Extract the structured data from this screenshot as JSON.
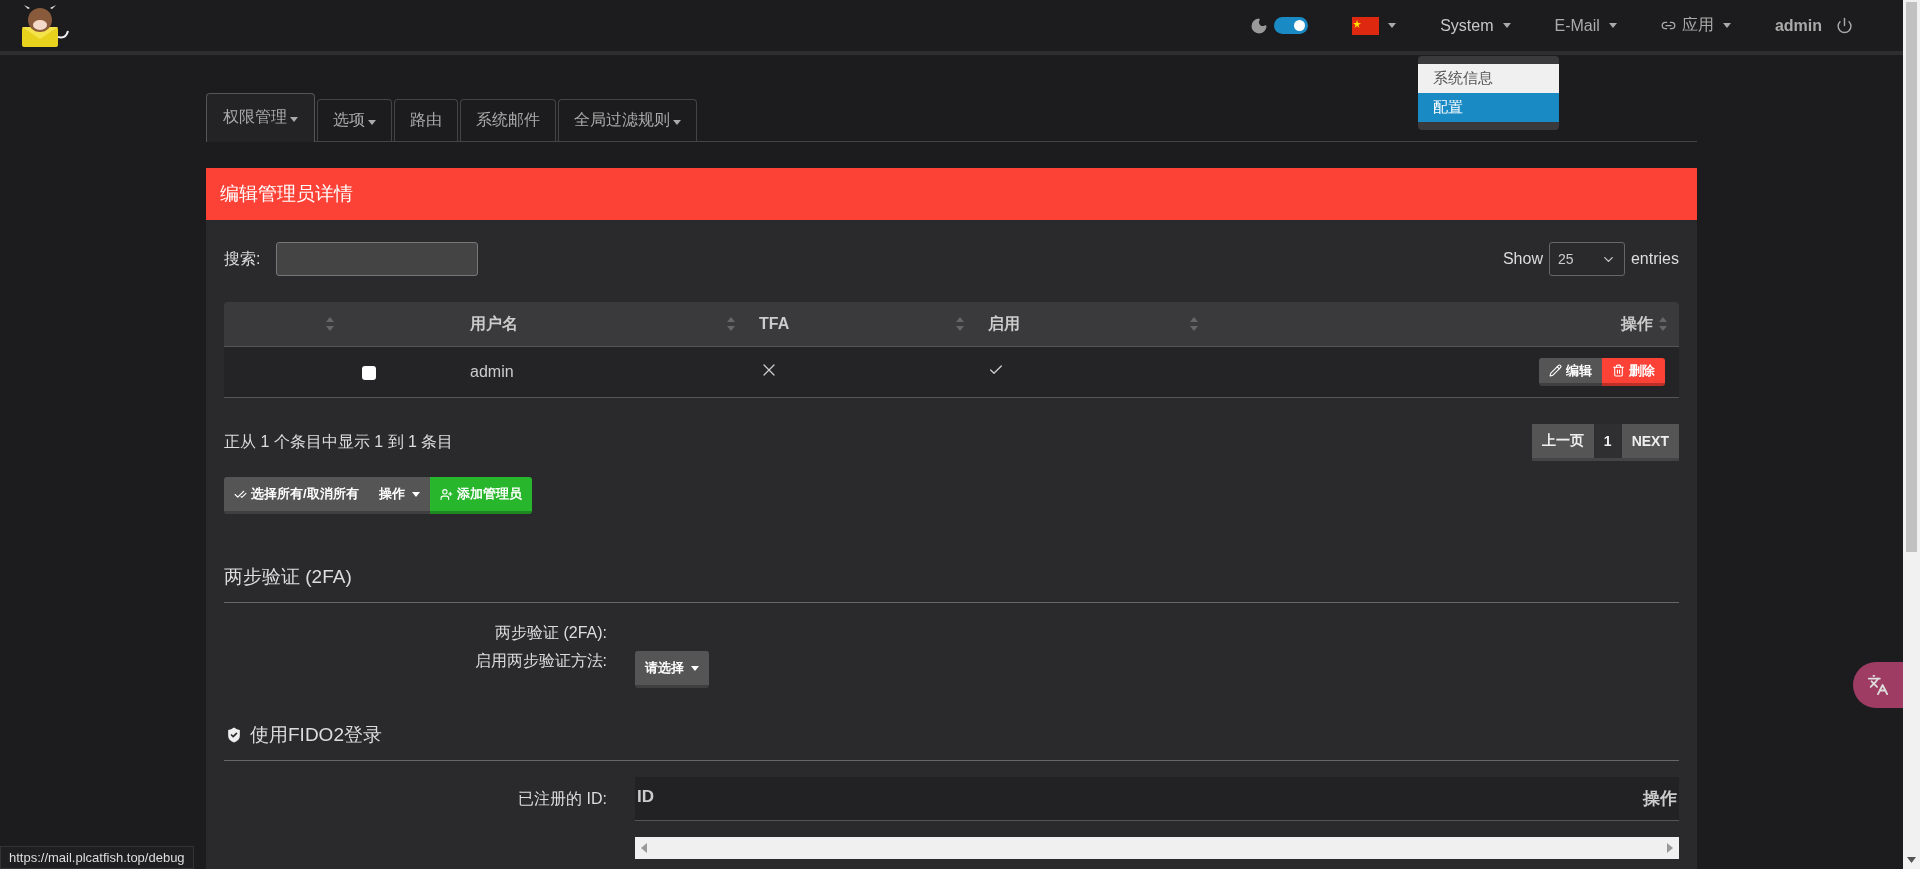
{
  "navbar": {
    "theme_toggle": {
      "on": true
    },
    "language": {
      "kind": "flag"
    },
    "menus": [
      {
        "label": "System",
        "kind": "text",
        "expanded": true,
        "items": [
          {
            "label": "系统信息",
            "selected": false
          },
          {
            "label": "配置",
            "selected": true
          }
        ]
      },
      {
        "label": "E-Mail",
        "kind": "text",
        "expanded": false
      },
      {
        "label": "应用",
        "kind": "link",
        "expanded": false
      }
    ],
    "user": "admin"
  },
  "tabs": [
    {
      "label": "权限管理",
      "selected": true,
      "dropdown": true
    },
    {
      "label": "选项",
      "selected": false,
      "dropdown": true
    },
    {
      "label": "路由",
      "selected": false,
      "dropdown": false
    },
    {
      "label": "系统邮件",
      "selected": false,
      "dropdown": false
    },
    {
      "label": "全局过滤规则",
      "selected": false,
      "dropdown": true
    }
  ],
  "panel": {
    "title": "编辑管理员详情",
    "search_label": "搜索:",
    "length": {
      "show": "Show",
      "value": "25",
      "entries": "entries"
    },
    "table": {
      "columns": [
        "用户名",
        "TFA",
        "启用",
        "操作"
      ],
      "rows": [
        {
          "checked": false,
          "username": "admin",
          "tfa": false,
          "active": true,
          "actions": [
            {
              "label": "编辑",
              "kind": "edit"
            },
            {
              "label": "删除",
              "kind": "delete"
            }
          ]
        }
      ]
    },
    "info": "正从 1 个条目中显示 1 到 1 条目",
    "pagination": [
      {
        "label": "上一页",
        "selected": false
      },
      {
        "label": "1",
        "selected": true
      },
      {
        "label": "NEXT",
        "selected": false
      }
    ],
    "bulk_buttons": [
      {
        "label": "选择所有/取消所有",
        "kind": "select-all"
      },
      {
        "label": "操作",
        "kind": "dropdown"
      },
      {
        "label": "添加管理员",
        "kind": "add"
      }
    ],
    "two_fa": {
      "heading": "两步验证 (2FA)",
      "labels": [
        "两步验证 (2FA):",
        "启用两步验证方法:"
      ],
      "select": "请选择"
    },
    "fido": {
      "heading": "使用FIDO2登录",
      "label": "已注册的 ID:",
      "columns": [
        "ID",
        "操作"
      ]
    }
  },
  "status_url": "https://mail.plcatfish.top/debug"
}
